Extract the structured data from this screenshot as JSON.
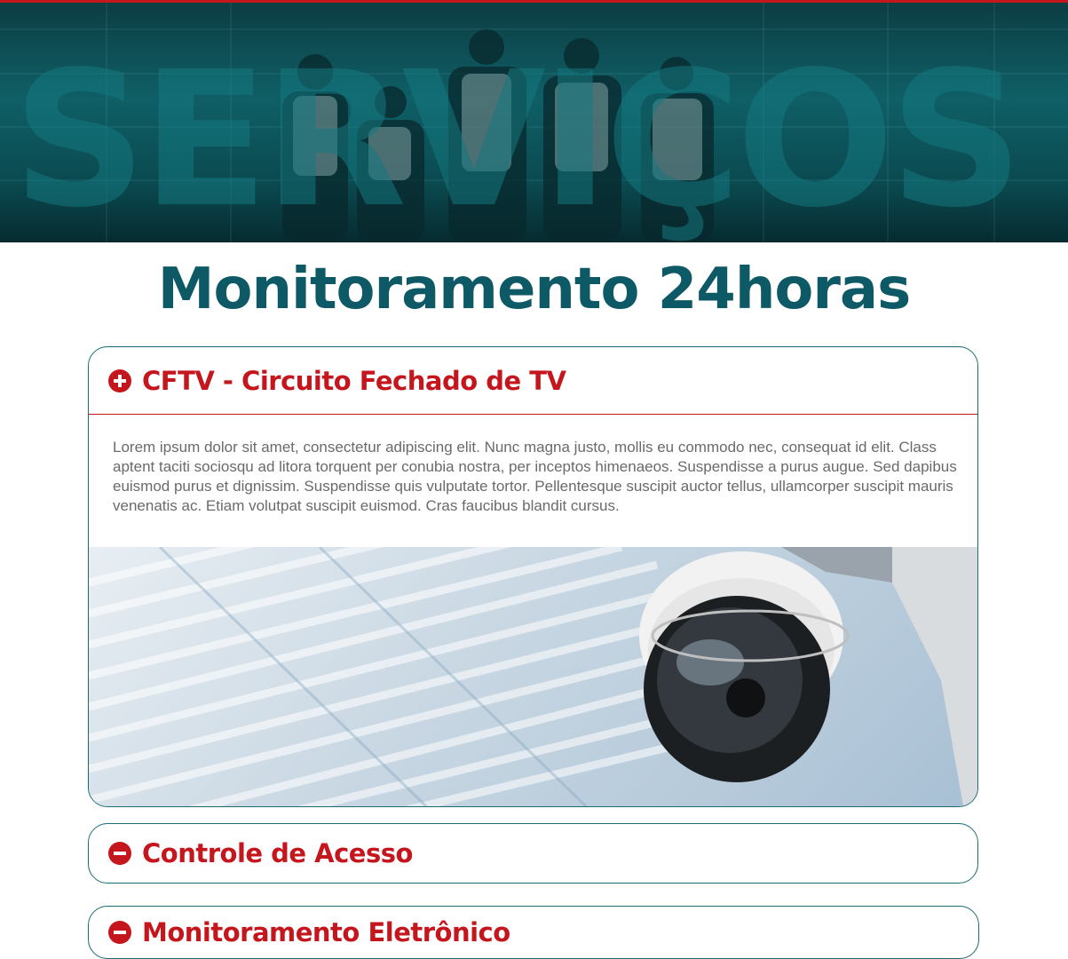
{
  "banner": {
    "word": "Serviços",
    "image_icon": "team-photo-image",
    "accent_color": "#c4161c",
    "tint_color": "#0f5f66"
  },
  "page": {
    "title": "Monitoramento 24horas",
    "title_color": "#0d5965"
  },
  "accordion": {
    "items": [
      {
        "title": "CFTV - Circuito Fechado de TV",
        "icon": "plus-circle-icon",
        "expanded": true,
        "body": "Lorem ipsum dolor sit amet, consectetur adipiscing elit. Nunc magna justo, mollis eu commodo nec, consequat id elit. Class aptent taciti sociosqu ad litora torquent per conubia nostra, per inceptos himenaeos. Suspendisse a purus augue. Sed dapibus euismod purus et dignissim. Suspendisse quis vulputate tortor. Pellentesque suscipit auctor tellus, ullamcor­per suscipit mauris venenatis ac. Etiam volutpat suscipit euismod. Cras faucibus blandit cursus.",
        "image_icon": "security-camera-image"
      },
      {
        "title": "Controle de Acesso",
        "icon": "minus-circle-icon",
        "expanded": false
      },
      {
        "title": "Monitoramento Eletrônico",
        "icon": "minus-circle-icon",
        "expanded": false
      }
    ],
    "header_color": "#c4161c",
    "border_color": "#1b6a74"
  }
}
